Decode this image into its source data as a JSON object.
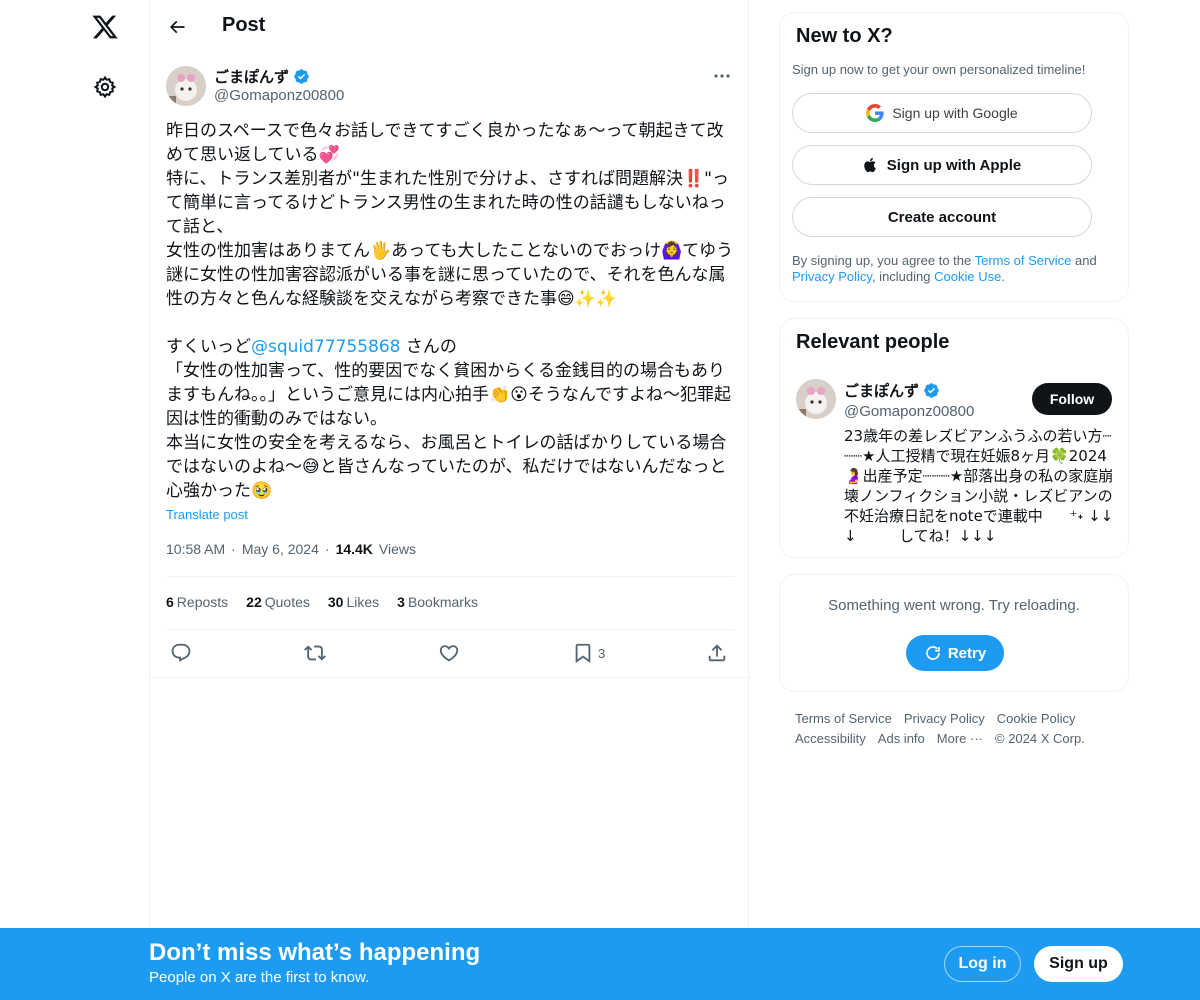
{
  "nav": {
    "logo_icon": "x-logo-icon",
    "settings_icon": "gear-icon"
  },
  "header": {
    "title": "Post",
    "back_icon": "arrow-left-icon"
  },
  "post": {
    "author_name": "ごまぽんず",
    "author_handle": "@Gomaponz00800",
    "text_part1": "昨日のスペースで色々お話しできてすごく良かったなぁ〜って朝起きて改めて思い返している💞\n特に、トランス差別者が\"生まれた性別で分けよ、さすれば問題解決‼️\"って簡単に言ってるけどトランス男性の生まれた時の性の話譴もしないねって話と、\n女性の性加害はありまてん🖐️あっても大したことないのでおっけ🙆‍♀️てゆう謎に女性の性加害容認派がいる事を謎に思っていたので、それを色んな属性の方々と色んな経験談を交えながら考察できた事😄✨✨\n\nすくいっど",
    "mention": "@squid77755868",
    "text_part2": " さんの\n「女性の性加害って、性的要因でなく貧困からくる金銭目的の場合もありますもんね。。」というご意見には内心拍手👏😮そうなんですよね〜犯罪起因は性的衝動のみではない。\n本当に女性の安全を考えるなら、お風呂とトイレの話ばかりしている場合ではないのよね〜😅と皆さんなっていたのが、私だけではないんだなっと心強かった🥹",
    "translate": "Translate post",
    "time": "10:58 AM",
    "date": "May 6, 2024",
    "views_count": "14.4K",
    "views_label": "Views",
    "stats": [
      {
        "count": "6",
        "label": "Reposts"
      },
      {
        "count": "22",
        "label": "Quotes"
      },
      {
        "count": "30",
        "label": "Likes"
      },
      {
        "count": "3",
        "label": "Bookmarks"
      }
    ],
    "bookmark_count": "3"
  },
  "signup": {
    "title": "New to X?",
    "subtitle": "Sign up now to get your own personalized timeline!",
    "google": "Sign up with Google",
    "apple": "Sign up with Apple",
    "create": "Create account",
    "legal_1": "By signing up, you agree to the ",
    "terms": "Terms of Service",
    "legal_2": " and ",
    "privacy": "Privacy Policy",
    "legal_3": ", including ",
    "cookie": "Cookie Use",
    "legal_4": "."
  },
  "people": {
    "title": "Relevant people",
    "name": "ごまぽんず",
    "handle": "@Gomaponz00800",
    "follow": "Follow",
    "bio": "23歳年の差レズビアンふうふの若い方┈┈┈★人工授精で現在妊娠8ヶ月🍀2024🤰出産予定┈┈┈★部落出身の私の家庭崩壊ノンフィクション小説・レズビアンの不妊治療日記をnoteで連載中⠀⠀ ⁺˖ ↓↓↓ ⠀⠀ ⠀してね！↓↓↓"
  },
  "error": {
    "message": "Something went wrong. Try reloading.",
    "retry": "Retry"
  },
  "footer": {
    "row1": [
      "Terms of Service",
      "Privacy Policy",
      "Cookie Policy"
    ],
    "row2": [
      "Accessibility",
      "Ads info",
      "More ···",
      "© 2024 X Corp."
    ]
  },
  "bottom_bar": {
    "title": "Don’t miss what’s happening",
    "subtitle": "People on X are the first to know.",
    "login": "Log in",
    "signup": "Sign up"
  },
  "colors": {
    "accent": "#1d9bf0",
    "text": "#0f1419",
    "muted": "#536471",
    "border": "#eff3f4"
  }
}
